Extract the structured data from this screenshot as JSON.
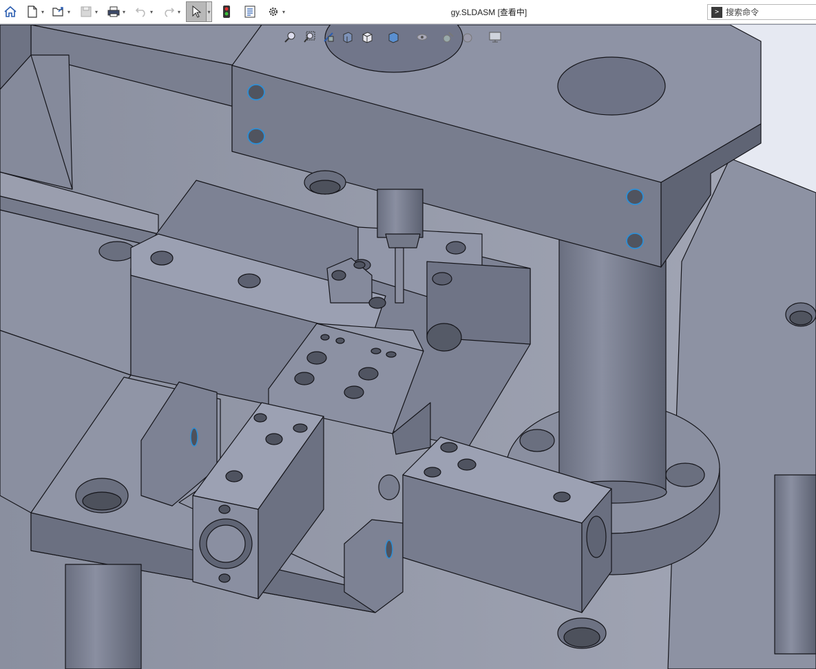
{
  "document": {
    "title": "gy.SLDASM [查看中]"
  },
  "search": {
    "placeholder": "搜索命令"
  },
  "toolbar": {
    "icons": [
      "home-icon",
      "new-document-icon",
      "open-icon",
      "save-icon",
      "print-icon",
      "undo-icon",
      "redo-icon",
      "select-icon",
      "rebuild-icon",
      "file-properties-icon",
      "options-icon"
    ]
  },
  "colors": {
    "model_top": "#8e93a6",
    "model_side": "#737889",
    "model_dark": "#5f6474",
    "edge": "#1a1a1f",
    "hole_highlight": "#2e8fd6"
  }
}
